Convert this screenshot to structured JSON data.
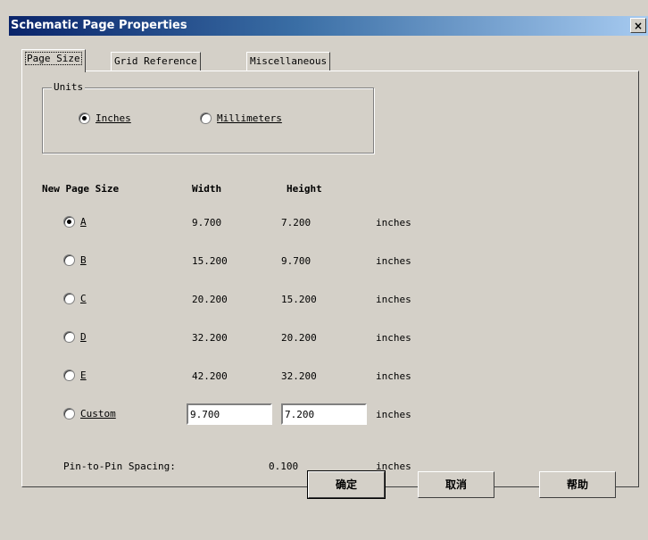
{
  "window": {
    "title": "Schematic Page Properties",
    "close_glyph": "×"
  },
  "tabs": [
    {
      "label": "Page Size",
      "active": true
    },
    {
      "label": "Grid Reference"
    },
    {
      "label": "Miscellaneous"
    }
  ],
  "units": {
    "legend": "Units",
    "options": [
      {
        "label": "Inches",
        "checked": true
      },
      {
        "label": "Millimeters",
        "checked": false
      }
    ]
  },
  "table": {
    "headers": {
      "size": "New Page Size",
      "width": "Width",
      "height": "Height"
    },
    "rows": [
      {
        "size": "A",
        "width": "9.700",
        "height": "7.200",
        "unit": "inches",
        "checked": true
      },
      {
        "size": "B",
        "width": "15.200",
        "height": "9.700",
        "unit": "inches",
        "checked": false
      },
      {
        "size": "C",
        "width": "20.200",
        "height": "15.200",
        "unit": "inches",
        "checked": false
      },
      {
        "size": "D",
        "width": "32.200",
        "height": "20.200",
        "unit": "inches",
        "checked": false
      },
      {
        "size": "E",
        "width": "42.200",
        "height": "32.200",
        "unit": "inches",
        "checked": false
      }
    ],
    "custom": {
      "label": "Custom",
      "width": "9.700",
      "height": "7.200",
      "unit": "inches",
      "checked": false
    }
  },
  "pin_spacing": {
    "label": "Pin-to-Pin Spacing:",
    "value": "0.100",
    "unit": "inches"
  },
  "buttons": {
    "ok": "确定",
    "cancel": "取消",
    "help": "帮助"
  }
}
